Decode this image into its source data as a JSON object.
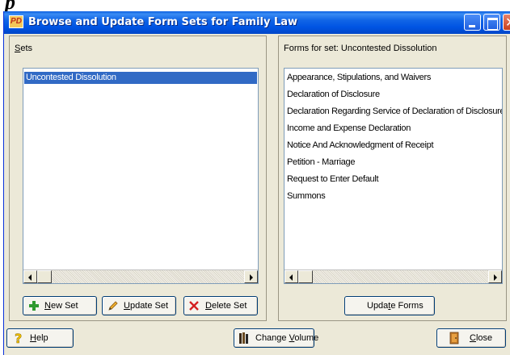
{
  "window": {
    "title": "Browse and Update Form Sets for Family Law",
    "app_icon_text": "PD"
  },
  "sets_panel": {
    "label": "Sets",
    "items": [
      {
        "label": "Uncontested Dissolution",
        "selected": true
      }
    ],
    "buttons": {
      "new_set": "New Set",
      "update_set": "Update Set",
      "delete_set": "Delete Set"
    }
  },
  "forms_panel": {
    "label": "Forms for set: Uncontested Dissolution",
    "items": [
      "Appearance, Stipulations, and Waivers",
      "Declaration of Disclosure",
      "Declaration Regarding Service of Declaration of Disclosure",
      "Income and Expense Declaration",
      "Notice And Acknowledgment of Receipt",
      "Petition - Marriage",
      "Request to Enter Default",
      "Summons"
    ],
    "update_forms_button": "Update Forms"
  },
  "footer": {
    "help_button": "Help",
    "change_volume_button": "Change Volume",
    "close_button": "Close"
  },
  "colors": {
    "titlebar": "#0054e3",
    "selection": "#316ac5",
    "window_bg": "#ece9d8"
  },
  "icons": {
    "new_set": "plus-icon",
    "update_set": "pencil-icon",
    "delete_set": "x-icon",
    "help": "question-icon",
    "change_volume": "books-icon",
    "close": "door-icon"
  }
}
